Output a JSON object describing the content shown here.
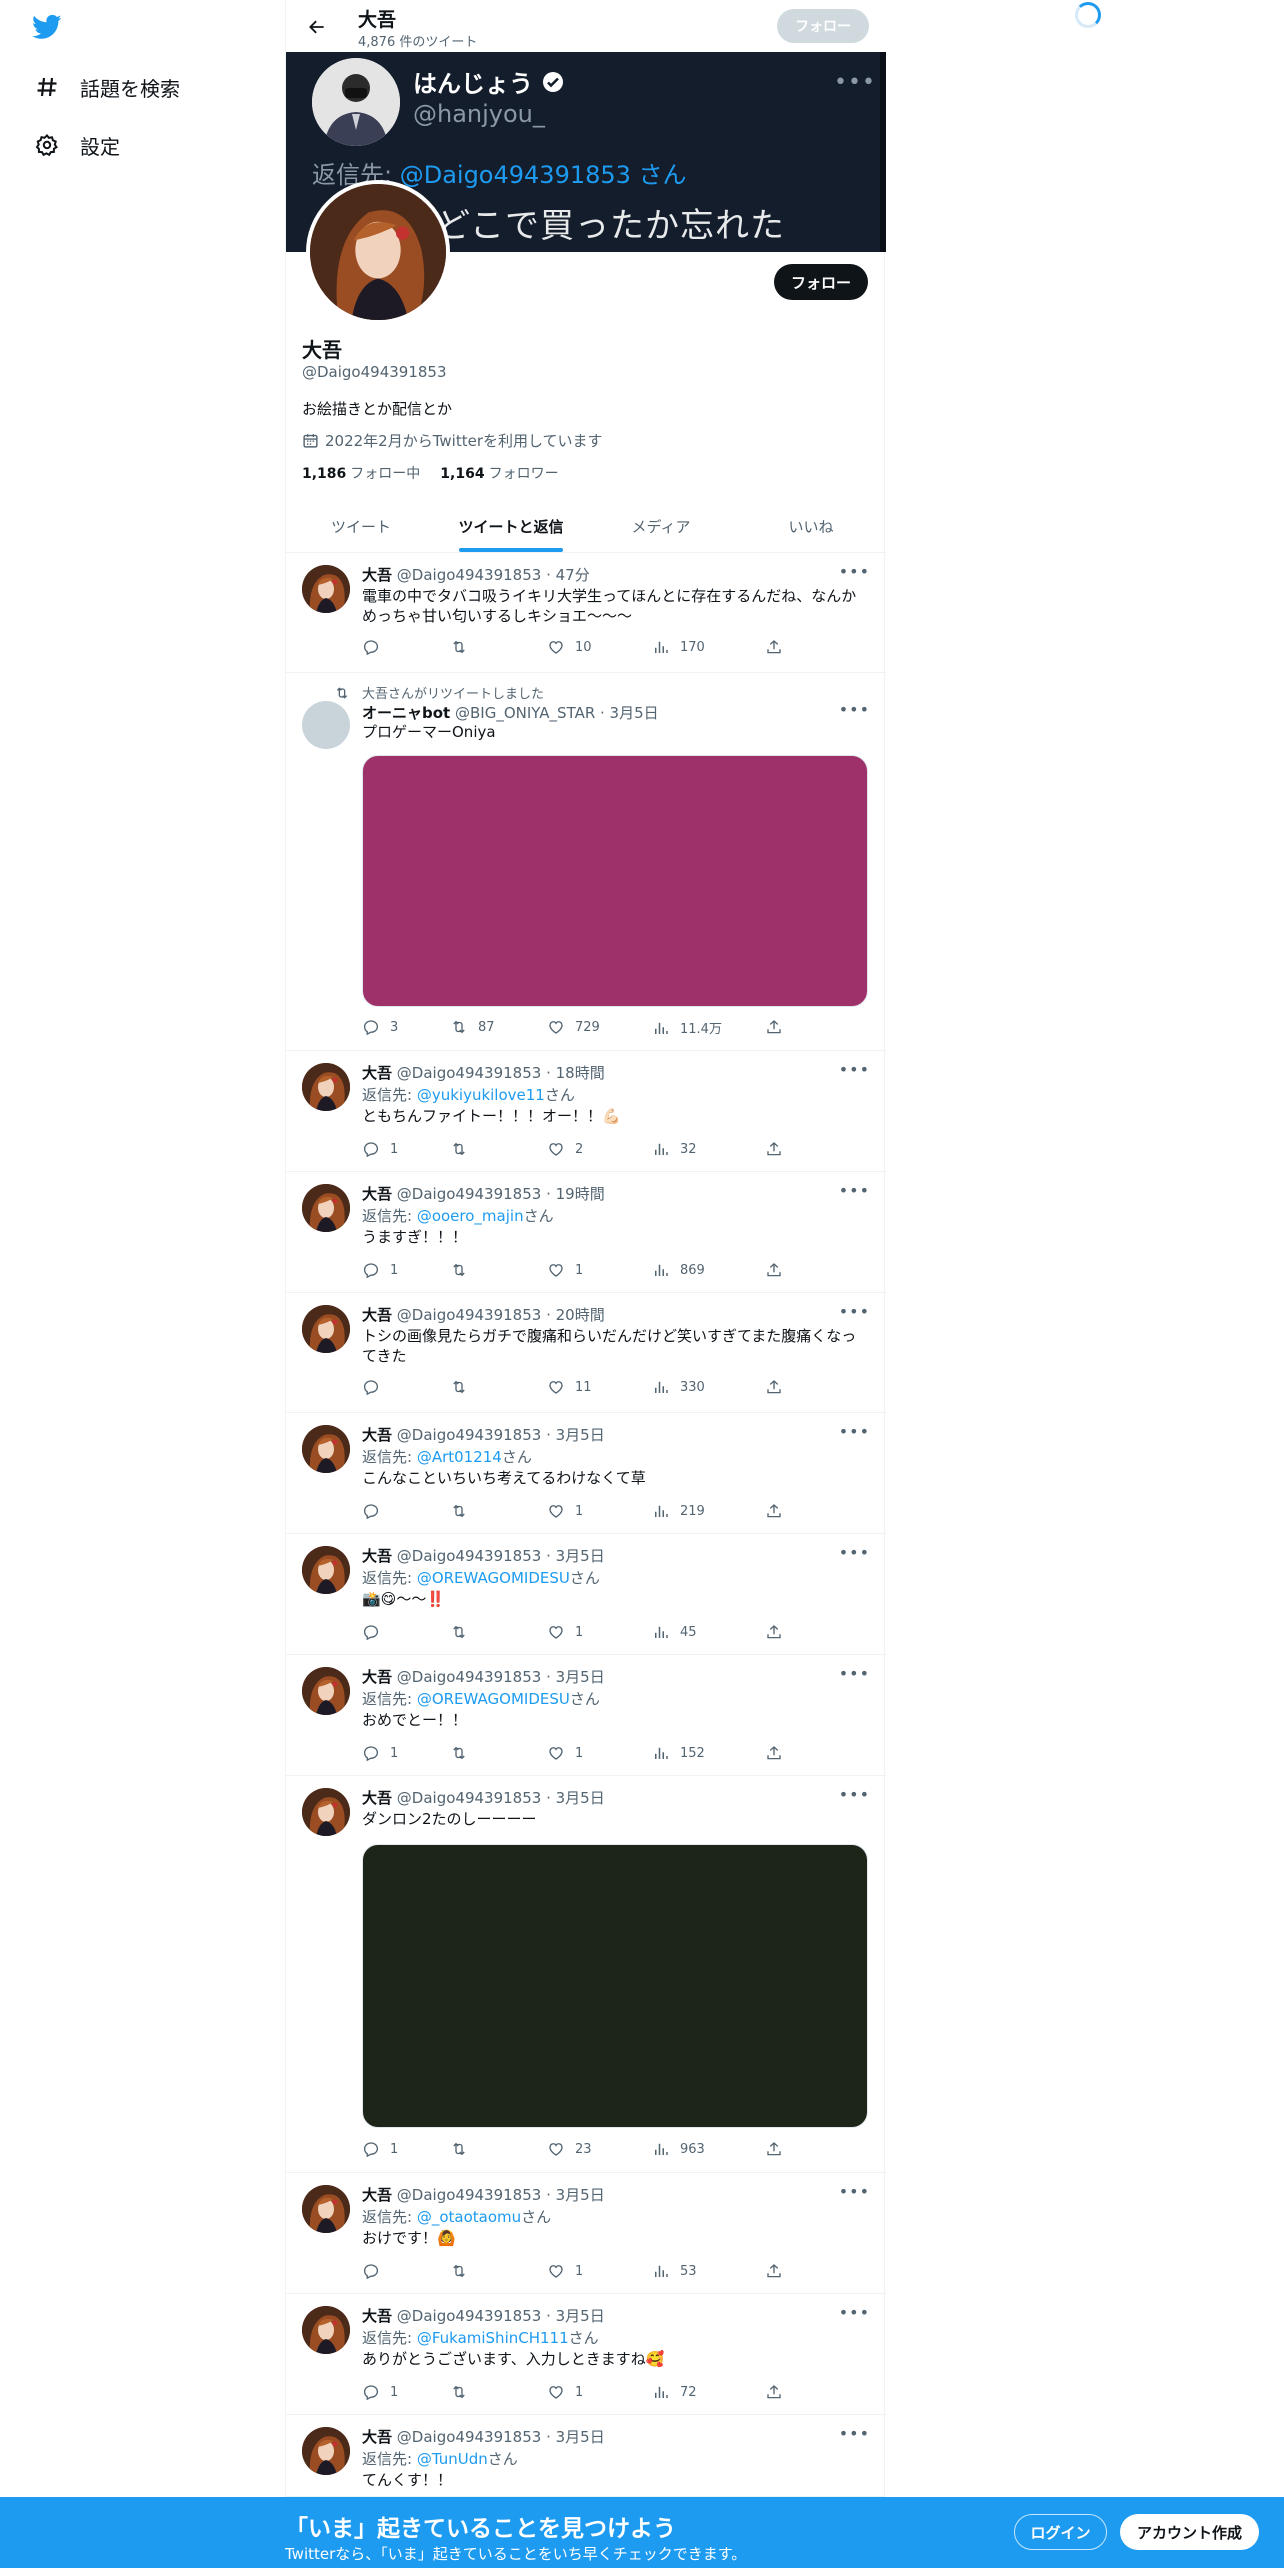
{
  "colors": {
    "brand": "#1d9bf0",
    "text": "#0f1419",
    "muted": "#536471",
    "banner": "#141d2b"
  },
  "sidebar": {
    "logo_icon": "twitter-bird-icon",
    "items": [
      {
        "label": "話題を検索",
        "icon": "hashtag-icon"
      },
      {
        "label": "設定",
        "icon": "gear-icon"
      }
    ]
  },
  "header": {
    "title": "大吾",
    "subtitle": "4,876 件のツイート",
    "follow_label": "フォロー"
  },
  "banner": {
    "name": "はんじょう",
    "handle": "@hanjyou_",
    "reply_prefix": "返信先: ",
    "reply_user": "@Daigo494391853 さん",
    "text": "どこで買ったか忘れた"
  },
  "profile": {
    "name": "大吾",
    "handle": "@Daigo494391853",
    "bio": "お絵描きとか配信とか",
    "joined": "2022年2月からTwitterを利用しています",
    "following_count": "1,186",
    "following_label": "フォロー中",
    "followers_count": "1,164",
    "followers_label": "フォロワー",
    "follow_label": "フォロー"
  },
  "tabs": [
    {
      "label": "ツイート"
    },
    {
      "label": "ツイートと返信"
    },
    {
      "label": "メディア"
    },
    {
      "label": "いいね"
    }
  ],
  "tweets": [
    {
      "name": "大吾",
      "meta": "@Daigo494391853 · 47分",
      "text": "電車の中でタバコ吸うイキリ大学生ってほんとに存在するんだね、なんかめっちゃ甘い匂いするしキショエ〜〜〜",
      "replies": "",
      "retweets": "",
      "likes": "10",
      "views": "170"
    },
    {
      "retweet_label": "大吾さんがリツイートしました",
      "name": "オーニャbot",
      "meta": "@BIG_ONIYA_STAR · 3月5日",
      "text": "プロゲーマーOniya",
      "media_color": "#9e3169",
      "replies": "3",
      "retweets": "87",
      "likes": "729",
      "views": "11.4万"
    },
    {
      "name": "大吾",
      "meta": "@Daigo494391853 · 18時間",
      "reply_prefix": "返信先: ",
      "reply_user": "@yukiyukilove11",
      "reply_suffix": "さん",
      "text": "ともちんファイトー！！！オー！！💪🏻",
      "replies": "1",
      "retweets": "",
      "likes": "2",
      "views": "32"
    },
    {
      "name": "大吾",
      "meta": "@Daigo494391853 · 19時間",
      "reply_prefix": "返信先: ",
      "reply_user": "@ooero_majin",
      "reply_suffix": "さん",
      "text": "うますぎ！！！",
      "replies": "1",
      "retweets": "",
      "likes": "1",
      "views": "869"
    },
    {
      "name": "大吾",
      "meta": "@Daigo494391853 · 20時間",
      "text": "トシの画像見たらガチで腹痛和らいだんだけど笑いすぎてまた腹痛くなってきた",
      "replies": "",
      "retweets": "",
      "likes": "11",
      "views": "330"
    },
    {
      "name": "大吾",
      "meta": "@Daigo494391853 · 3月5日",
      "reply_prefix": "返信先: ",
      "reply_user": "@Art01214",
      "reply_suffix": "さん",
      "text": "こんなこといちいち考えてるわけなくて草",
      "replies": "",
      "retweets": "",
      "likes": "1",
      "views": "219"
    },
    {
      "name": "大吾",
      "meta": "@Daigo494391853 · 3月5日",
      "reply_prefix": "返信先: ",
      "reply_user": "@OREWAGOMIDESU",
      "reply_suffix": "さん",
      "text": "📸😋〜〜‼️",
      "replies": "",
      "retweets": "",
      "likes": "1",
      "views": "45"
    },
    {
      "name": "大吾",
      "meta": "@Daigo494391853 · 3月5日",
      "reply_prefix": "返信先: ",
      "reply_user": "@OREWAGOMIDESU",
      "reply_suffix": "さん",
      "text": "おめでとー！！",
      "replies": "1",
      "retweets": "",
      "likes": "1",
      "views": "152"
    },
    {
      "name": "大吾",
      "meta": "@Daigo494391853 · 3月5日",
      "text": "ダンロン2たのしーーーー",
      "media_color": "#1d2519",
      "replies": "1",
      "retweets": "",
      "likes": "23",
      "views": "963"
    },
    {
      "name": "大吾",
      "meta": "@Daigo494391853 · 3月5日",
      "reply_prefix": "返信先: ",
      "reply_user": "@_otaotaomu",
      "reply_suffix": "さん",
      "text": "おけです！🙆",
      "replies": "",
      "retweets": "",
      "likes": "1",
      "views": "53"
    },
    {
      "name": "大吾",
      "meta": "@Daigo494391853 · 3月5日",
      "reply_prefix": "返信先: ",
      "reply_user": "@FukamiShinCH111",
      "reply_suffix": "さん",
      "text": "ありがとうございます、入力しときますね🥰",
      "replies": "1",
      "retweets": "",
      "likes": "1",
      "views": "72"
    },
    {
      "name": "大吾",
      "meta": "@Daigo494391853 · 3月5日",
      "reply_prefix": "返信先: ",
      "reply_user": "@TunUdn",
      "reply_suffix": "さん",
      "text": "てんくす！！"
    }
  ],
  "bottom_bar": {
    "title": "「いま」起きていることを見つけよう",
    "subtitle": "Twitterなら、「いま」起きていることをいち早くチェックできます。",
    "login_label": "ログイン",
    "signup_label": "アカウント作成"
  }
}
